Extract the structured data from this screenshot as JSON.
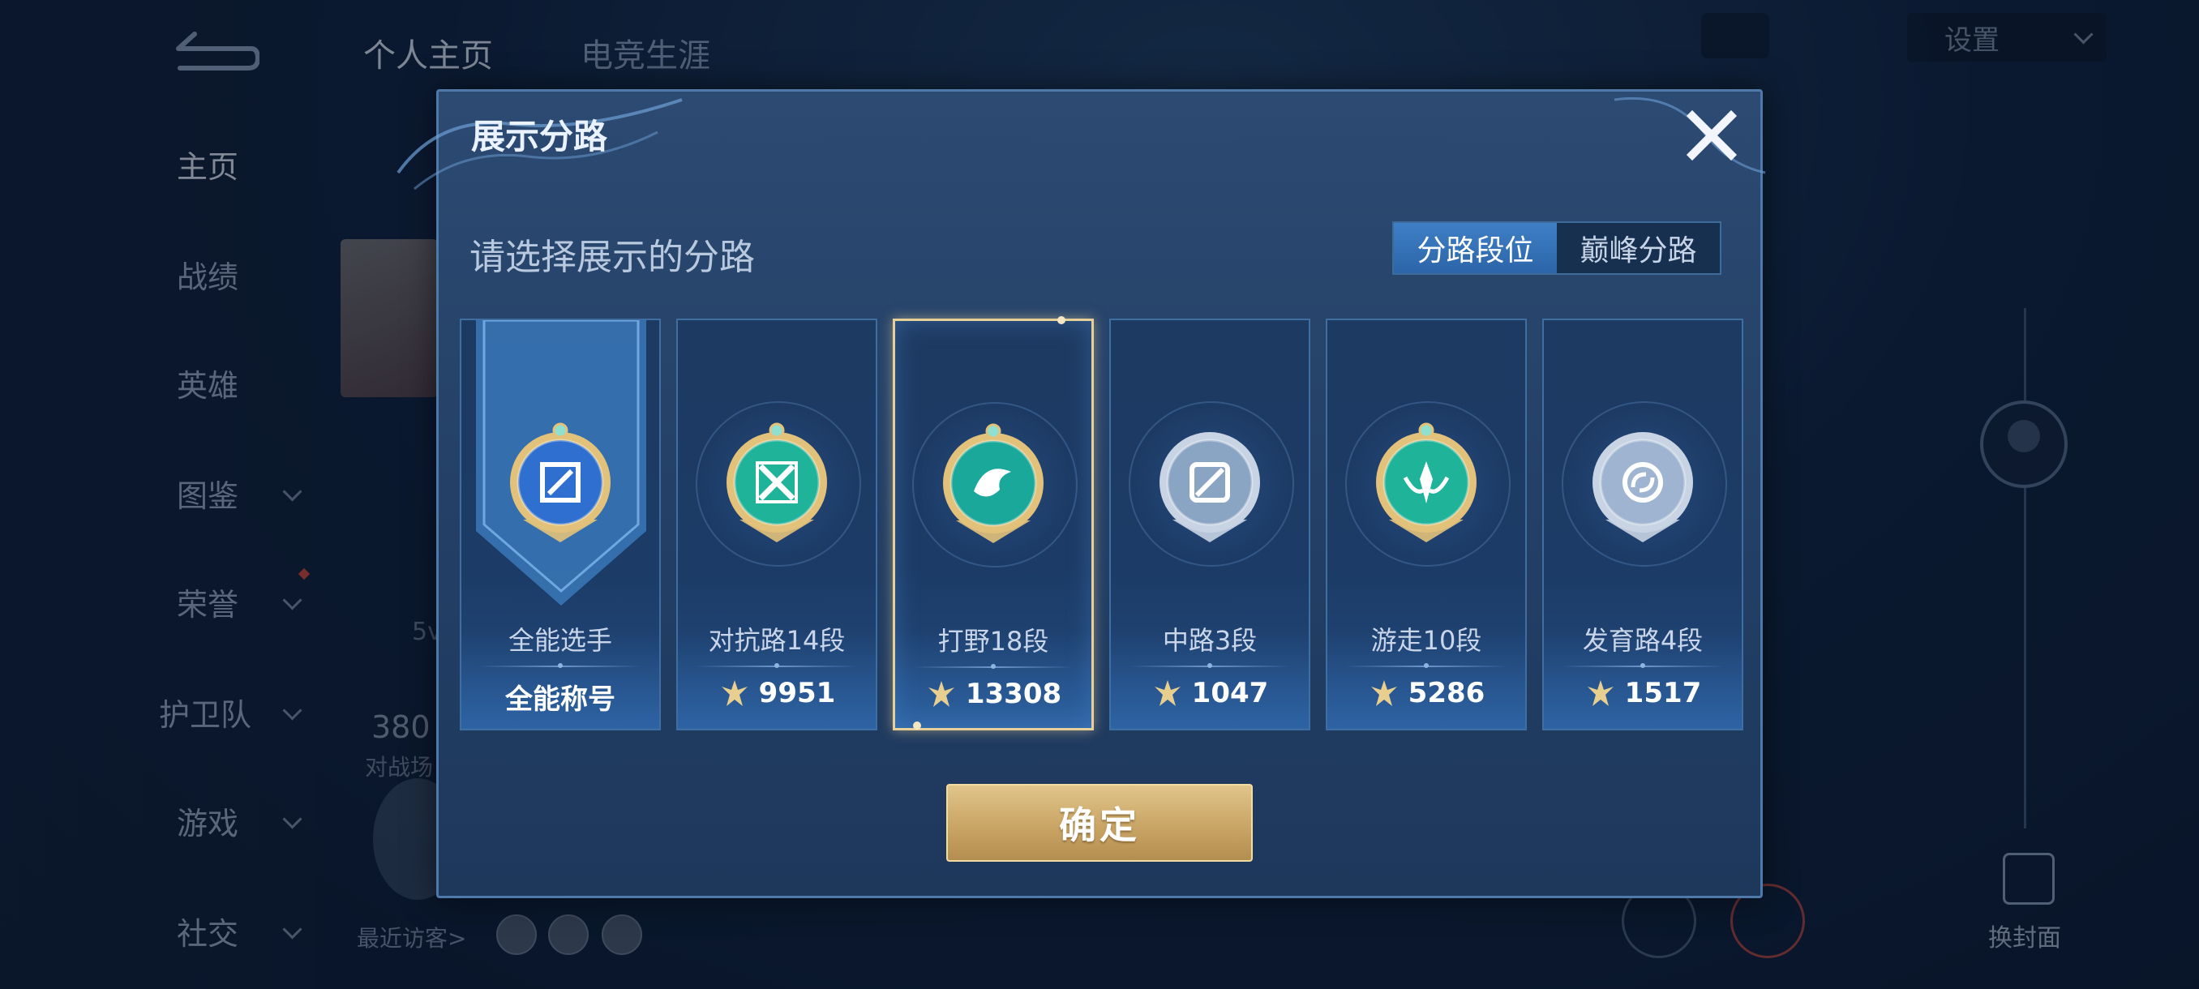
{
  "background": {
    "tabs": [
      "个人主页",
      "电竞生涯"
    ],
    "settings_label": "设置",
    "sidebar": [
      {
        "label": "主页",
        "dropdown": false,
        "active": true
      },
      {
        "label": "战绩",
        "dropdown": false
      },
      {
        "label": "英雄",
        "dropdown": false
      },
      {
        "label": "图鉴",
        "dropdown": true
      },
      {
        "label": "荣誉",
        "dropdown": true
      },
      {
        "label": "护卫队",
        "dropdown": true
      },
      {
        "label": "游戏",
        "dropdown": true
      },
      {
        "label": "社交",
        "dropdown": true
      }
    ],
    "stat_number": "380",
    "stat_label": "对战场",
    "badge_text": "5v",
    "recent_visitors": "最近访客>",
    "change_cover": "换封面"
  },
  "modal": {
    "title": "展示分路",
    "subtitle": "请选择展示的分路",
    "toggle": {
      "active": "分路段位",
      "inactive": "巅峰分路"
    },
    "cards": [
      {
        "name": "全能选手",
        "value": "全能称号",
        "icon": "all-round-emblem-icon",
        "emblem_color": "#2f6fd0",
        "selected": false
      },
      {
        "name": "对抗路14段",
        "value": "9951",
        "icon": "clash-lane-emblem-icon",
        "emblem_color": "#1fb39a",
        "selected": false
      },
      {
        "name": "打野18段",
        "value": "13308",
        "icon": "jungle-emblem-icon",
        "emblem_color": "#1aa89a",
        "selected": true
      },
      {
        "name": "中路3段",
        "value": "1047",
        "icon": "mid-lane-emblem-icon",
        "emblem_color": "#8aa4c4",
        "selected": false
      },
      {
        "name": "游走10段",
        "value": "5286",
        "icon": "roam-emblem-icon",
        "emblem_color": "#1fb39a",
        "selected": false
      },
      {
        "name": "发育路4段",
        "value": "1517",
        "icon": "farm-lane-emblem-icon",
        "emblem_color": "#9eb4d0",
        "selected": false
      }
    ],
    "confirm_label": "确定"
  },
  "colors": {
    "accent_gold": "#d7b97a",
    "selected_border": "#e7cf9a",
    "toggle_blue": "#3a78bf"
  }
}
